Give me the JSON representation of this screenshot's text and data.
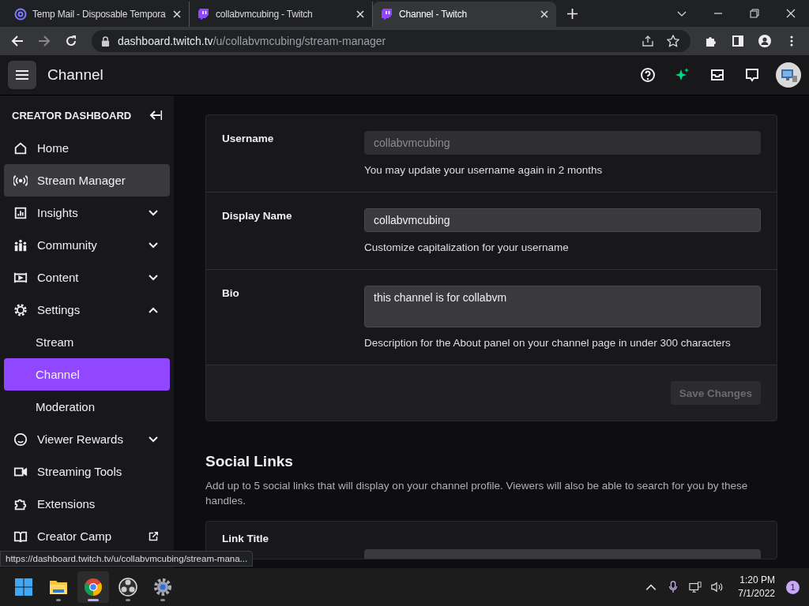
{
  "browser": {
    "tabs": [
      {
        "title": "Temp Mail - Disposable Tempora",
        "selected": false
      },
      {
        "title": "collabvmcubing - Twitch",
        "selected": false
      },
      {
        "title": "Channel - Twitch",
        "selected": true
      }
    ],
    "address": {
      "domain": "dashboard.twitch.tv",
      "path": "/u/collabvmcubing/stream-manager"
    }
  },
  "header": {
    "title": "Channel"
  },
  "sidebar": {
    "heading": "CREATOR DASHBOARD",
    "items": [
      {
        "label": "Home",
        "selected": false,
        "hovered": false
      },
      {
        "label": "Stream Manager",
        "selected": false,
        "hovered": true
      },
      {
        "label": "Insights",
        "selected": false,
        "hovered": false,
        "expanded": false
      },
      {
        "label": "Community",
        "selected": false,
        "hovered": false,
        "expanded": false
      },
      {
        "label": "Content",
        "selected": false,
        "hovered": false,
        "expanded": false
      },
      {
        "label": "Settings",
        "selected": false,
        "hovered": false,
        "expanded": true,
        "children": [
          {
            "label": "Stream",
            "selected": false
          },
          {
            "label": "Channel",
            "selected": true
          },
          {
            "label": "Moderation",
            "selected": false
          }
        ]
      },
      {
        "label": "Viewer Rewards",
        "selected": false,
        "hovered": false,
        "expanded": false
      },
      {
        "label": "Streaming Tools",
        "selected": false,
        "hovered": false
      },
      {
        "label": "Extensions",
        "selected": false,
        "hovered": false
      },
      {
        "label": "Creator Camp",
        "selected": false,
        "hovered": false,
        "external": true
      }
    ]
  },
  "profile_form": {
    "rows": [
      {
        "label": "Username",
        "kind": "input",
        "value": "collabvmcubing",
        "disabled": true,
        "help": "You may update your username again in 2 months"
      },
      {
        "label": "Display Name",
        "kind": "input",
        "value": "collabvmcubing",
        "disabled": false,
        "help": "Customize capitalization for your username"
      },
      {
        "label": "Bio",
        "kind": "textarea",
        "value": "this channel is for collabvm",
        "disabled": false,
        "help": "Description for the About panel on your channel page in under 300 characters"
      }
    ],
    "save_button": {
      "label": "Save Changes",
      "disabled": true
    }
  },
  "social_links": {
    "heading": "Social Links",
    "description": "Add up to 5 social links that will display on your channel profile. Viewers will also be able to search for you by these handles.",
    "card_label": "Link Title"
  },
  "status_url": "https://dashboard.twitch.tv/u/collabvmcubing/stream-mana...",
  "taskbar": {
    "apps": [
      {
        "running": false,
        "active": false
      },
      {
        "running": true,
        "active": false
      },
      {
        "running": true,
        "active": true
      },
      {
        "running": true,
        "active": false
      },
      {
        "running": true,
        "active": false
      }
    ],
    "time": "1:20 PM",
    "date": "7/1/2022",
    "notifications": "1"
  }
}
